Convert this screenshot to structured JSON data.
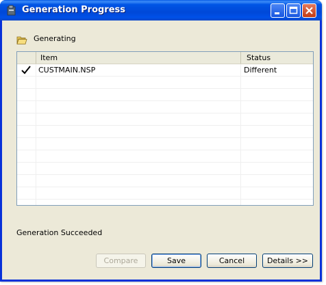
{
  "window": {
    "title": "Generation Progress",
    "icons": {
      "app": "app-icon",
      "minimize": "minimize-icon",
      "maximize": "maximize-icon",
      "close": "close-icon"
    }
  },
  "section": {
    "label": "Generating",
    "icon": "open-folder-icon"
  },
  "table": {
    "columns": [
      "",
      "Item",
      "Status"
    ],
    "rows": [
      {
        "checked": true,
        "item": "CUSTMAIN.NSP",
        "status": "Different"
      }
    ]
  },
  "status_message": "Generation Succeeded",
  "buttons": {
    "compare": "Compare",
    "save": "Save",
    "cancel": "Cancel",
    "details": "Details >>"
  },
  "colors": {
    "titlebar": "#0055e5",
    "window_bg": "#ece9d8",
    "table_border": "#7f9db9"
  }
}
